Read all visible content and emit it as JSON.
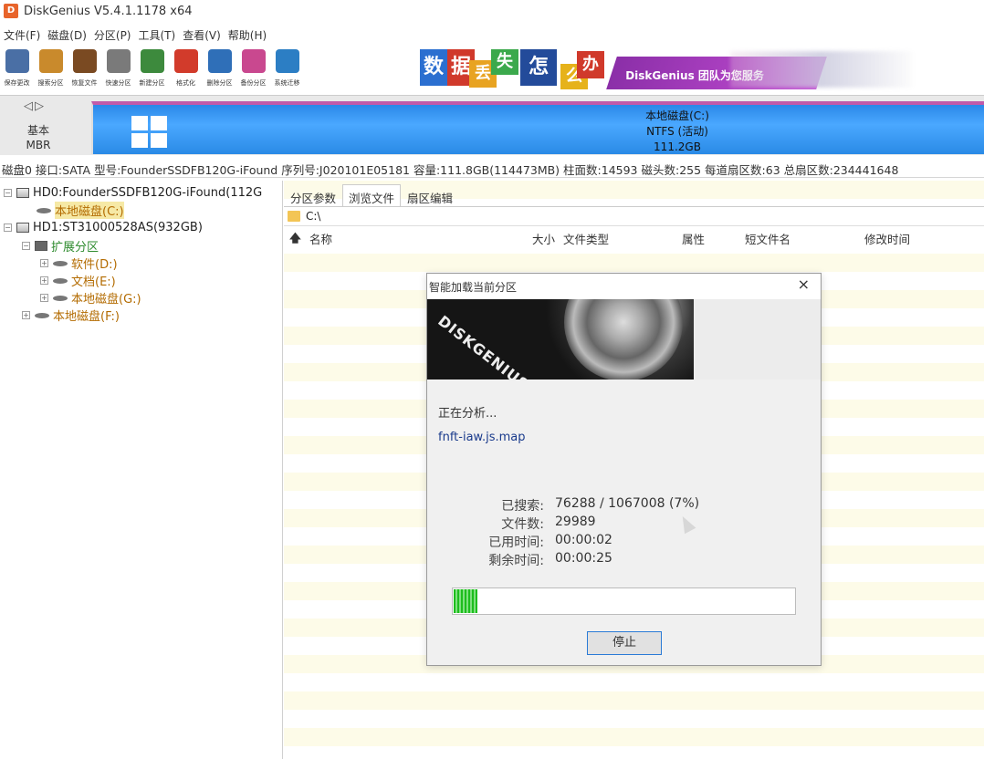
{
  "window": {
    "title": "DiskGenius V5.4.1.1178 x64",
    "icon_letter": "D"
  },
  "menu": [
    "文件(F)",
    "磁盘(D)",
    "分区(P)",
    "工具(T)",
    "查看(V)",
    "帮助(H)"
  ],
  "toolbar": {
    "buttons": [
      {
        "label": "保存更改",
        "icon": "save-icon",
        "color": "#4a6fa5"
      },
      {
        "label": "搜索分区",
        "icon": "search-icon",
        "color": "#c98a2c"
      },
      {
        "label": "恢复文件",
        "icon": "recover-icon",
        "color": "#7a4a22"
      },
      {
        "label": "快速分区",
        "icon": "quick-partition-icon",
        "color": "#7a7a7a"
      },
      {
        "label": "新建分区",
        "icon": "new-partition-icon",
        "color": "#3d8a3d"
      },
      {
        "label": "格式化",
        "icon": "format-icon",
        "color": "#d23b2b"
      },
      {
        "label": "删除分区",
        "icon": "delete-icon",
        "color": "#2f6fb8"
      },
      {
        "label": "备份分区",
        "icon": "backup-icon",
        "color": "#c9488f"
      },
      {
        "label": "系统迁移",
        "icon": "migrate-icon",
        "color": "#2c7ec4"
      }
    ]
  },
  "banner": {
    "tiles": [
      "数",
      "据",
      "丢",
      "失",
      "怎",
      "么",
      "办"
    ],
    "brand_text": "DiskGenius 团队为您服务"
  },
  "disk_map": {
    "nav": "◁▷",
    "disk_type": "基本",
    "partition_style": "MBR",
    "partition": {
      "name": "本地磁盘(C:)",
      "fs": "NTFS (活动)",
      "size": "111.2GB"
    }
  },
  "disk_info": "磁盘0 接口:SATA  型号:FounderSSDFB120G-iFound  序列号:J020101E05181  容量:111.8GB(114473MB)  柱面数:14593  磁头数:255  每道扇区数:63  总扇区数:234441648",
  "tree": {
    "items": [
      {
        "label": "HD0:FounderSSDFB120G-iFound(112G",
        "kind": "disk",
        "expander": "−"
      },
      {
        "label": "本地磁盘(C:)",
        "kind": "partition",
        "selected": true
      },
      {
        "label": "HD1:ST31000528AS(932GB)",
        "kind": "disk",
        "expander": "−"
      },
      {
        "label": "扩展分区",
        "kind": "extended",
        "expander": "−"
      },
      {
        "label": "软件(D:)",
        "kind": "partition",
        "expander": "+"
      },
      {
        "label": "文档(E:)",
        "kind": "partition",
        "expander": "+"
      },
      {
        "label": "本地磁盘(G:)",
        "kind": "partition",
        "expander": "+"
      },
      {
        "label": "本地磁盘(F:)",
        "kind": "partition",
        "expander": "+"
      }
    ]
  },
  "tabs": [
    "分区参数",
    "浏览文件",
    "扇区编辑"
  ],
  "active_tab": "浏览文件",
  "path": "C:\\",
  "columns": {
    "name": "名称",
    "size": "大小",
    "type": "文件类型",
    "attr": "属性",
    "short_name": "短文件名",
    "modified": "修改时间"
  },
  "dialog": {
    "title": "智能加载当前分区",
    "close": "×",
    "art_text": "DISKGENIUS",
    "status": "正在分析...",
    "current_file": "fnft-iaw.js.map",
    "stats": [
      {
        "key": "已搜索:",
        "value": "76288 / 1067008 (7%)"
      },
      {
        "key": "文件数:",
        "value": "29989"
      },
      {
        "key": "已用时间:",
        "value": "00:00:02"
      },
      {
        "key": "剩余时间:",
        "value": "00:00:25"
      }
    ],
    "progress_fraction": 0.07,
    "stop_label": "停止"
  }
}
